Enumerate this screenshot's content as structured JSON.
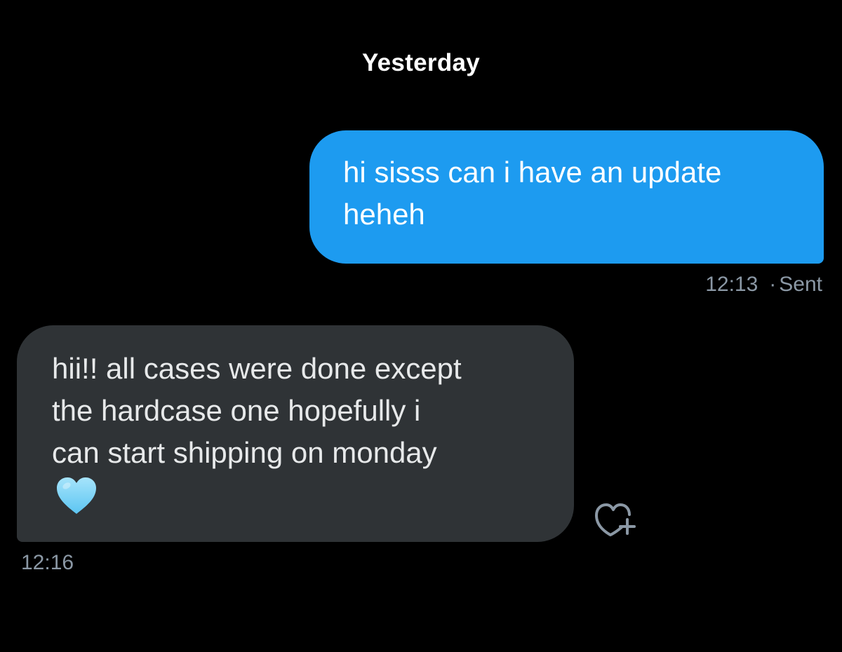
{
  "conversation": {
    "date_separator": "Yesterday",
    "messages": [
      {
        "direction": "sent",
        "text": "hi sisss can i have an update\nheheh",
        "time": "12:13",
        "separator": "·",
        "status": "Sent"
      },
      {
        "direction": "received",
        "text": "hii!! all cases were done except\nthe hardcase one hopefully i\ncan start shipping on monday",
        "emoji": "light-blue-heart-icon",
        "time": "12:16"
      }
    ],
    "react_action_icon": "heart-plus-icon"
  },
  "colors": {
    "background": "#000000",
    "sent_bubble": "#1d9bf0",
    "received_bubble": "#2f3336",
    "meta_text": "#8b98a5",
    "heart_emoji": "#7fd3f7"
  }
}
